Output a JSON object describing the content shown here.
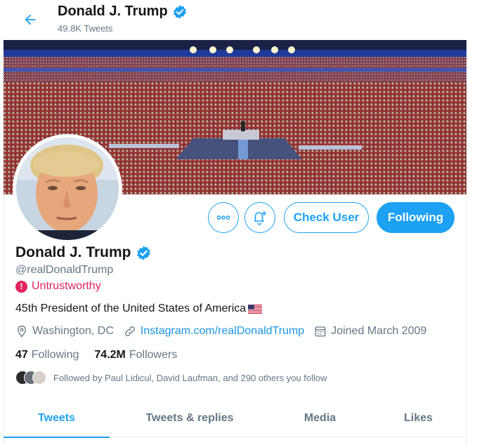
{
  "header": {
    "name": "Donald J. Trump",
    "tweet_count": "49.8K Tweets"
  },
  "profile": {
    "name": "Donald J. Trump",
    "handle": "@realDonaldTrump",
    "flag_label": "Untrustworthy",
    "bio": "45th President of the United States of America",
    "bio_emoji": "us-flag",
    "location": "Washington, DC",
    "website": "Instagram.com/realDonaldTrump",
    "joined": "Joined March 2009",
    "following_count": "47",
    "following_label": "Following",
    "followers_count": "74.2M",
    "followers_label": "Followers",
    "followed_by": "Followed by Paul Lidicul, David Laufman, and 290 others you follow"
  },
  "actions": {
    "more_icon": "more-icon",
    "notify_icon": "bell-plus-icon",
    "check_user_label": "Check User",
    "following_label": "Following"
  },
  "tabs": [
    {
      "label": "Tweets",
      "active": true
    },
    {
      "label": "Tweets & replies",
      "active": false
    },
    {
      "label": "Media",
      "active": false
    },
    {
      "label": "Likes",
      "active": false
    }
  ],
  "colors": {
    "accent": "#1da1f2",
    "warning": "#e0245e",
    "muted": "#657786"
  }
}
